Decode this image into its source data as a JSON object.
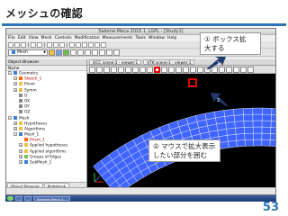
{
  "slide": {
    "title": "メッシュの確認",
    "page_number": "53",
    "accent_color": "#2e75b6"
  },
  "window": {
    "title": "Salome-Meca 2015.1_LGPL - [Study1]"
  },
  "menu": [
    {
      "label": "File"
    },
    {
      "label": "Edit"
    },
    {
      "label": "View"
    },
    {
      "label": "Mesh"
    },
    {
      "label": "Controls"
    },
    {
      "label": "Modification"
    },
    {
      "label": "Measurements"
    },
    {
      "label": "Tools"
    },
    {
      "label": "Window"
    },
    {
      "label": "Help"
    }
  ],
  "module_selector": {
    "value": "Mesh"
  },
  "object_browser": {
    "title": "Object Browser",
    "column_header": "Name",
    "items": [
      {
        "label": "Geometry",
        "indent": 0,
        "expander": "−",
        "icon_color": "#3a7fd0",
        "selected": false
      },
      {
        "label": "Sketch_1",
        "indent": 1,
        "expander": "+",
        "icon_color": "#ff6a00",
        "selected": true
      },
      {
        "label": "Prism",
        "indent": 1,
        "expander": "+",
        "icon_color": "#f0c040",
        "selected": false
      },
      {
        "label": "Symm",
        "indent": 1,
        "expander": "+",
        "icon_color": "#f0c040",
        "selected": false
      },
      {
        "label": "O",
        "indent": 1,
        "expander": "",
        "icon_color": "#888888",
        "selected": false
      },
      {
        "label": "OX",
        "indent": 1,
        "expander": "",
        "icon_color": "#888888",
        "selected": false
      },
      {
        "label": "OY",
        "indent": 1,
        "expander": "",
        "icon_color": "#888888",
        "selected": false
      },
      {
        "label": "OZ",
        "indent": 1,
        "expander": "",
        "icon_color": "#888888",
        "selected": false
      },
      {
        "label": "Mesh",
        "indent": 0,
        "expander": "−",
        "icon_color": "#3a7fd0",
        "selected": false
      },
      {
        "label": "Hypotheses",
        "indent": 1,
        "expander": "+",
        "icon_color": "#f0c040",
        "selected": false
      },
      {
        "label": "Algorithms",
        "indent": 1,
        "expander": "+",
        "icon_color": "#f0c040",
        "selected": false
      },
      {
        "label": "Mesh_1",
        "indent": 1,
        "expander": "−",
        "icon_color": "#3a7fd0",
        "selected": false
      },
      {
        "label": "Prism_1",
        "indent": 2,
        "expander": "",
        "icon_color": "#ff6a00",
        "selected": true
      },
      {
        "label": "Applied hypotheses",
        "indent": 2,
        "expander": "+",
        "icon_color": "#f0c040",
        "selected": false
      },
      {
        "label": "Applied algorithms",
        "indent": 2,
        "expander": "+",
        "icon_color": "#f0c040",
        "selected": false
      },
      {
        "label": "Groups of Edges",
        "indent": 2,
        "expander": "+",
        "icon_color": "#6fbf50",
        "selected": false
      },
      {
        "label": "SubMesh_1",
        "indent": 2,
        "expander": "+",
        "icon_color": "#3a7fd0",
        "selected": false
      }
    ],
    "tabs": [
      {
        "label": "Object Browser"
      },
      {
        "label": "Notebook"
      }
    ]
  },
  "viewer": {
    "tabs": [
      {
        "label": "OCC scene:1 - viewer:1"
      },
      {
        "label": "VTK scene:1 - viewer:1"
      }
    ],
    "mesh_color": "#3f64ff",
    "background": "#000000"
  },
  "taskbar": {
    "items": [
      {
        "label": ""
      },
      {
        "label": ""
      },
      {
        "label": "Salome-Meca 2..."
      }
    ]
  },
  "callouts": {
    "zoom_box": {
      "line1": "① ボックス拡",
      "line2": "大する"
    },
    "zoom_target": {
      "line1": "② マウスで拡大表示",
      "line2": "したい部分を囲む"
    },
    "arrow1_label": "1",
    "arrow2_label": "2",
    "arrow_color": "#1f3a6b"
  }
}
